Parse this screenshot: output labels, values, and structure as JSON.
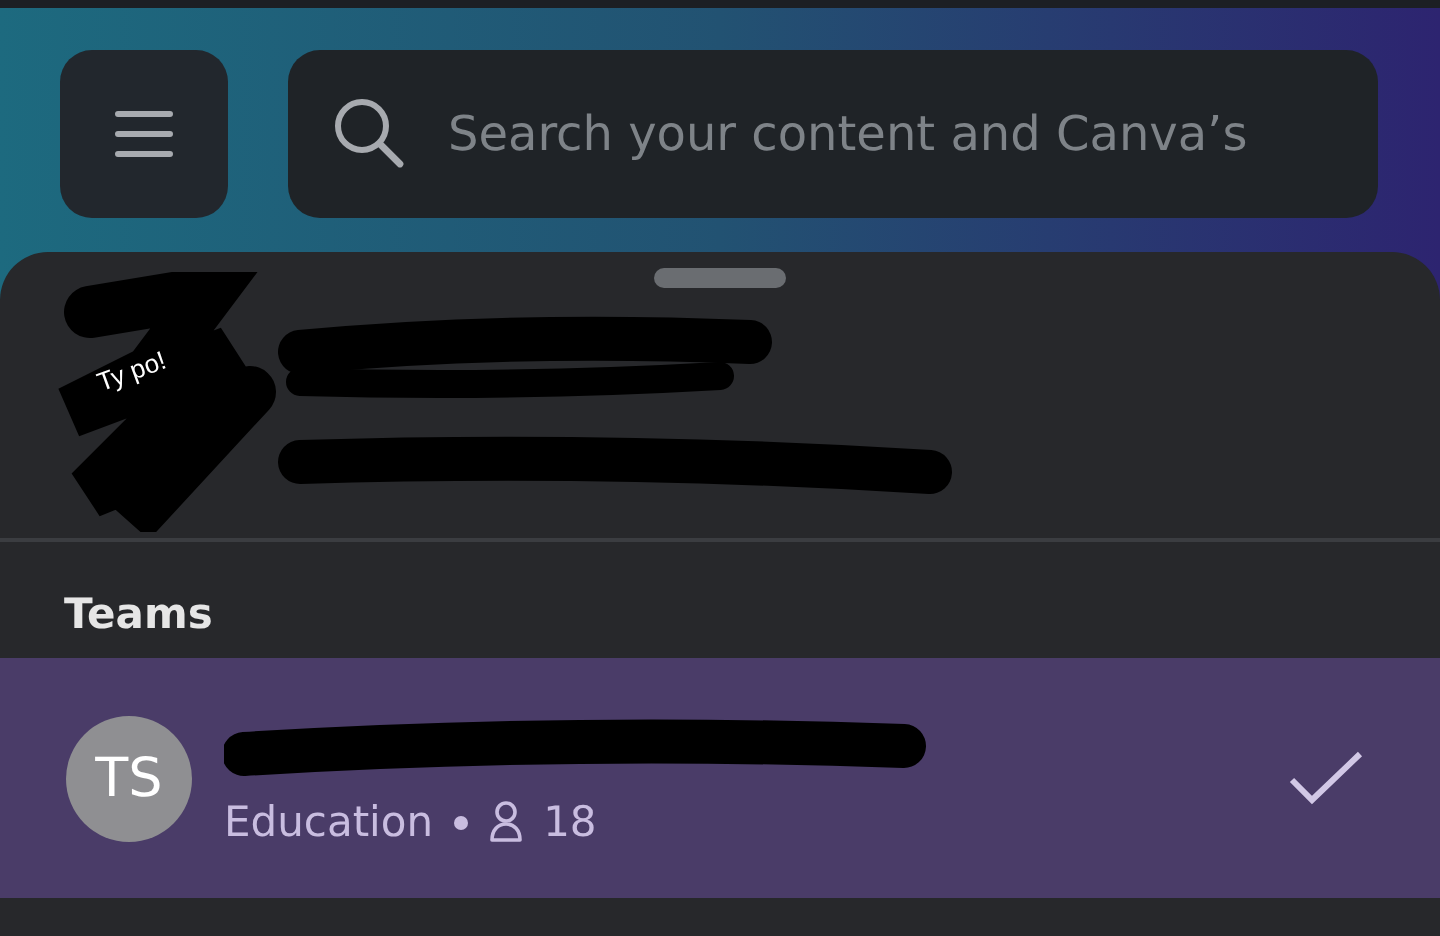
{
  "search": {
    "placeholder": "Search your content and Canva’s"
  },
  "account": {
    "annotation": "Ty po!"
  },
  "teams": {
    "heading": "Teams",
    "items": [
      {
        "initials": "TS",
        "type": "Education",
        "members": "18",
        "selected": true
      }
    ]
  }
}
